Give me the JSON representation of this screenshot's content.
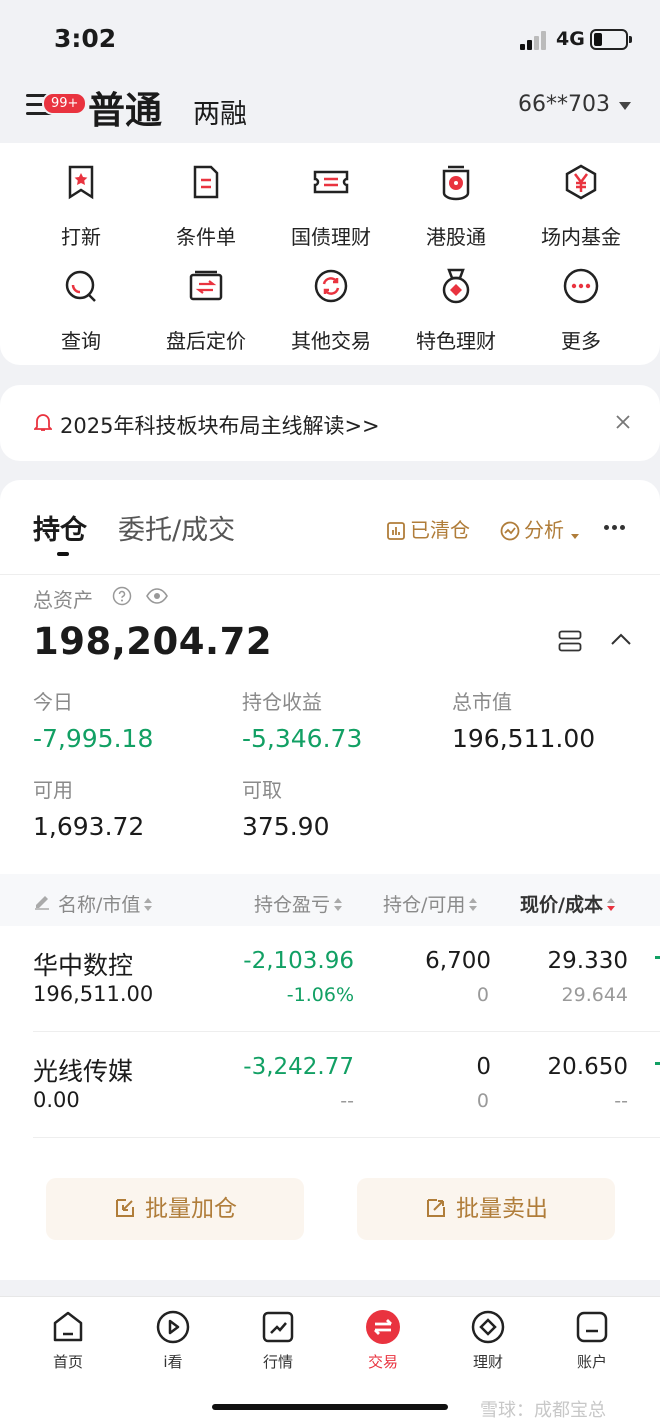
{
  "status_bar": {
    "time": "3:02",
    "network": "4G"
  },
  "header": {
    "badge": "99+",
    "mode_active": "普通",
    "mode_other": "两融",
    "account": "66**703"
  },
  "quick_grid": [
    {
      "label": "打新",
      "icon": "bookmark-star-icon"
    },
    {
      "label": "条件单",
      "icon": "document-lines-icon"
    },
    {
      "label": "国债理财",
      "icon": "ticket-icon"
    },
    {
      "label": "港股通",
      "icon": "hk-flag-icon"
    },
    {
      "label": "场内基金",
      "icon": "yuan-hexagon-icon"
    },
    {
      "label": "查询",
      "icon": "search-icon"
    },
    {
      "label": "盘后定价",
      "icon": "exchange-icon"
    },
    {
      "label": "其他交易",
      "icon": "refresh-icon"
    },
    {
      "label": "特色理财",
      "icon": "medal-icon"
    },
    {
      "label": "更多",
      "icon": "more-icon"
    }
  ],
  "banner": {
    "text": "2025年科技板块布局主线解读>>"
  },
  "holdings": {
    "tab_active": "持仓",
    "tab_other": "委托/成交",
    "tool_cleared": "已清仓",
    "tool_analysis": "分析",
    "total_assets_label": "总资产",
    "total_assets": "198,204.72",
    "stats": {
      "today_label": "今日",
      "today": "-7,995.18",
      "holding_pl_label": "持仓收益",
      "holding_pl": "-5,346.73",
      "market_value_label": "总市值",
      "market_value": "196,511.00",
      "available_label": "可用",
      "available": "1,693.72",
      "withdrawable_label": "可取",
      "withdrawable": "375.90"
    },
    "table_headers": {
      "name": "名称/市值",
      "pl": "持仓盈亏",
      "position": "持仓/可用",
      "price": "现价/成本"
    },
    "rows": [
      {
        "name": "华中数控",
        "market_value": "196,511.00",
        "pl": "-2,103.96",
        "pl_pct": "-1.06%",
        "qty": "6,700",
        "avail": "0",
        "price": "29.330",
        "cost": "29.644"
      },
      {
        "name": "光线传媒",
        "market_value": "0.00",
        "pl": "-3,242.77",
        "pl_pct": "--",
        "qty": "0",
        "avail": "0",
        "price": "20.650",
        "cost": "--"
      }
    ],
    "batch_add": "批量加仓",
    "batch_sell": "批量卖出"
  },
  "bottom_nav": [
    {
      "label": "首页",
      "icon": "home-icon"
    },
    {
      "label": "i看",
      "icon": "play-icon"
    },
    {
      "label": "行情",
      "icon": "chart-icon"
    },
    {
      "label": "交易",
      "icon": "trade-icon",
      "active": true
    },
    {
      "label": "理财",
      "icon": "diamond-icon"
    },
    {
      "label": "账户",
      "icon": "account-icon"
    }
  ],
  "watermark": "雪球：成都宝总",
  "colors": {
    "accent_red": "#e9333f",
    "gain_green": "#12a064",
    "gold": "#b07d3a"
  }
}
